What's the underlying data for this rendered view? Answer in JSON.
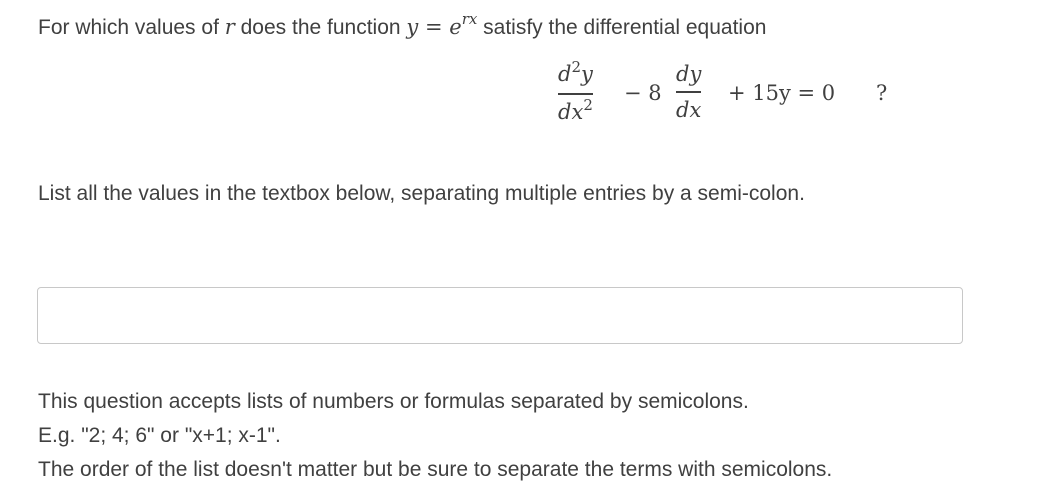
{
  "question": {
    "intro_before": "For which values of ",
    "var_r": "r",
    "intro_middle": " does the function ",
    "func_y": "y",
    "equals": " = ",
    "func_base": "e",
    "func_exp": "rx",
    "intro_after": " satisfy the differential equation"
  },
  "equation": {
    "term1_num_d": "d",
    "term1_num_sup": "2",
    "term1_num_var": "y",
    "term1_den_d": "dx",
    "term1_den_sup": "2",
    "minus_coef": "− 8",
    "term2_num": "dy",
    "term2_den": "dx",
    "rest": "+ 15y = 0",
    "question_mark": "?"
  },
  "instruction": "List all the values in the textbox below, separating multiple entries by a semi-colon.",
  "answer": {
    "value": "",
    "placeholder": ""
  },
  "help": {
    "line1": "This question accepts lists of numbers or formulas separated by semicolons.",
    "line2": "E.g. \"2; 4; 6\" or \"x+1; x-1\".",
    "line3": "The order of the list doesn't matter but be sure to separate the terms with semicolons."
  }
}
